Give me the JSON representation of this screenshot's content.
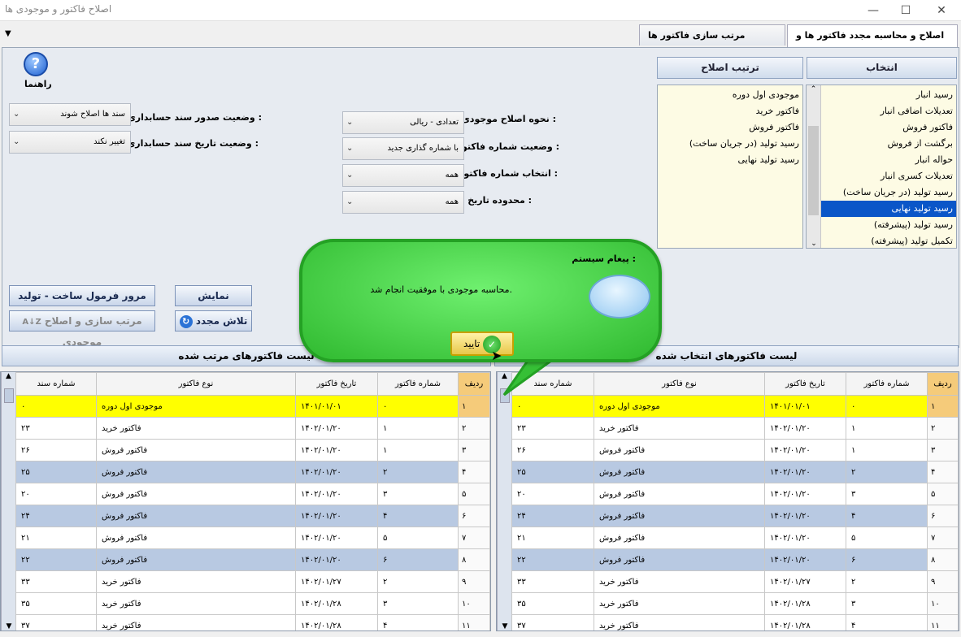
{
  "window": {
    "title": "اصلاح فاکتور و موجودی ها"
  },
  "tabs": [
    {
      "label": "اصلاح و محاسبه مجدد فاکتور ها و موجودی"
    },
    {
      "label": "مرتب سازی فاکتور ها براساس تاریخ"
    }
  ],
  "help": {
    "label": "راهنما"
  },
  "selection": {
    "header": "انتخاب",
    "items": [
      "رسید انبار",
      "تعدیلات اضافی انبار",
      "فاکتور فروش",
      "برگشت از فروش",
      "حواله انبار",
      "تعدیلات کسری انبار",
      "رسید تولید (در جریان ساخت)",
      "رسید تولید نهایی",
      "رسید تولید (پیشرفته)",
      "تکمیل تولید (پیشرفته)"
    ],
    "selected_index": 7
  },
  "order": {
    "header": "ترتیب اصلاح",
    "items": [
      "موجودی اول دوره",
      "فاکتور خرید",
      "فاکتور فروش",
      "رسید تولید (در جریان ساخت)",
      "رسید تولید نهایی"
    ]
  },
  "settings": {
    "inventory_mode_label": "نحوه اصلاح موجودی :",
    "inventory_mode_value": "تعدادی - ریالی",
    "invoice_number_status_label": "وضعیت شماره فاکتور :",
    "invoice_number_status_value": "با شماره گذاری جدید",
    "invoice_number_select_label": "انتخاب شماره فاکتور :",
    "invoice_number_select_value": "همه",
    "date_range_label": "محدوده تاریخ :",
    "date_range_value": "همه",
    "doc_issue_label": "وضعیت صدور سند حسابداری :",
    "doc_issue_value": "سند ها اصلاح شوند",
    "doc_date_label": "وضعیت تاریخ سند حسابداری :",
    "doc_date_value": "تغییر نکند"
  },
  "buttons": {
    "show": "نمایش",
    "review": "مرور فرمول ساخت - تولید عادی",
    "retry": "تلاش مجدد",
    "sort_fix": "مرتب سازی و اصلاح موجودی"
  },
  "message": {
    "title": "پیغام سیستم :",
    "text": "محاسبه موجودی با موفقیت انجام شد.",
    "ok": "تایید"
  },
  "grid_headers": {
    "selected": "لیست فاکتورهای انتخاب شده",
    "sorted": "لیست فاکتورهای مرتب شده"
  },
  "columns": {
    "row": "ردیف",
    "number": "شماره فاکتور",
    "date": "تاریخ فاکتور",
    "type": "نوع فاکتور",
    "doc": "شماره سند"
  },
  "rows": [
    {
      "row": "۱",
      "number": "۰",
      "date": "۱۴۰۱/۰۱/۰۱",
      "type": "موجودی اول دوره",
      "doc": "۰"
    },
    {
      "row": "۲",
      "number": "۱",
      "date": "۱۴۰۲/۰۱/۲۰",
      "type": "فاکتور خرید",
      "doc": "۲۳"
    },
    {
      "row": "۳",
      "number": "۱",
      "date": "۱۴۰۲/۰۱/۲۰",
      "type": "فاکتور فروش",
      "doc": "۲۶"
    },
    {
      "row": "۴",
      "number": "۲",
      "date": "۱۴۰۲/۰۱/۲۰",
      "type": "فاکتور فروش",
      "doc": "۲۵"
    },
    {
      "row": "۵",
      "number": "۳",
      "date": "۱۴۰۲/۰۱/۲۰",
      "type": "فاکتور فروش",
      "doc": "۲۰"
    },
    {
      "row": "۶",
      "number": "۴",
      "date": "۱۴۰۲/۰۱/۲۰",
      "type": "فاکتور فروش",
      "doc": "۲۴"
    },
    {
      "row": "۷",
      "number": "۵",
      "date": "۱۴۰۲/۰۱/۲۰",
      "type": "فاکتور فروش",
      "doc": "۲۱"
    },
    {
      "row": "۸",
      "number": "۶",
      "date": "۱۴۰۲/۰۱/۲۰",
      "type": "فاکتور فروش",
      "doc": "۲۲"
    },
    {
      "row": "۹",
      "number": "۲",
      "date": "۱۴۰۲/۰۱/۲۷",
      "type": "فاکتور خرید",
      "doc": "۳۳"
    },
    {
      "row": "۱۰",
      "number": "۳",
      "date": "۱۴۰۲/۰۱/۲۸",
      "type": "فاکتور خرید",
      "doc": "۳۵"
    },
    {
      "row": "۱۱",
      "number": "۴",
      "date": "۱۴۰۲/۰۱/۲۸",
      "type": "فاکتور خرید",
      "doc": "۳۷"
    }
  ]
}
